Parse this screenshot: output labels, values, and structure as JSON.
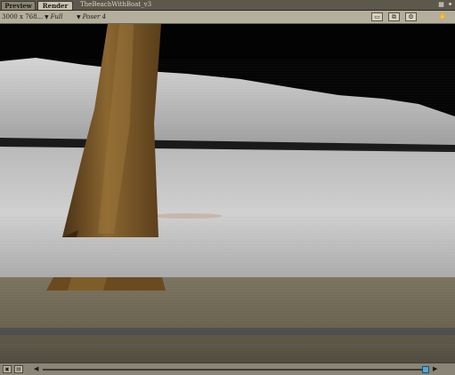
{
  "tabs": [
    {
      "label": "Preview",
      "active": false
    },
    {
      "label": "Render",
      "active": true
    }
  ],
  "document": {
    "title": "TheBeachWithBoat_v3"
  },
  "options": {
    "size": "3000 x 768...",
    "quality": "Full",
    "renderer": "Poser 4"
  },
  "icons": {
    "tab_right_1": "grid-icon",
    "tab_right_2": "hand-icon",
    "tool_1": "render-icon",
    "tool_2": "compare-icon",
    "tool_3": "settings-icon",
    "tool_4": "hand-icon"
  },
  "colors": {
    "sky": "#000000",
    "snow": "#c9c9c9",
    "tree_trunk": "#6b4a1f",
    "wooden_floor": "#6a6351",
    "scroll_thumb": "#4fa9d8"
  },
  "scroll": {
    "position": 0.97
  }
}
